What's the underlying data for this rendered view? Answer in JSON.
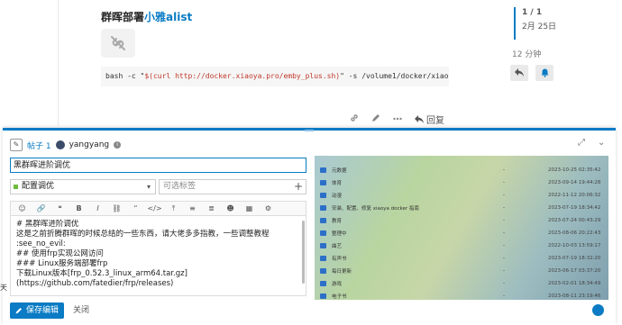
{
  "post": {
    "title_prefix": "群晖部署",
    "title_link": "小雅alist",
    "code_text_before": "bash -c \"",
    "code_string": "$(curl http://docker.xiaoya.pro/emby_plus.sh)",
    "code_text_after": "\" -s /volume1/docker/xiaoya-m"
  },
  "post_actions": {
    "reply_label": "回复"
  },
  "timeline": {
    "position": "1 / 1",
    "date": "2月 25日",
    "ago": "12 分钟"
  },
  "composer": {
    "reply_label": "帖子 1",
    "username": "yangyang",
    "title_value": "黑群晖进阶调优",
    "category": "配置调优",
    "category_color": "#6dbb3b",
    "tags_placeholder": "可选标签",
    "editor_text": "# 黑群晖进阶调优\n这是之前折腾群晖的时候总结的一些东西，请大佬多多指教，一些调整教程\n:see_no_evil:\n## 使用frp实现公网访问\n### Linux服务端部署frp\n下载Linux版本[frp_0.52.3_linux_arm64.tar.gz]\n(https://github.com/fatedier/frp/releases)",
    "save_label": "保存编辑",
    "close_label": "关闭",
    "accent_color": "#0a7bc4"
  },
  "preview": {
    "rows": [
      {
        "name": "元数据",
        "size": "-",
        "date": "2023-10-25 02:35:42"
      },
      {
        "name": "体育",
        "size": "-",
        "date": "2023-09-14 19:44:28"
      },
      {
        "name": "动漫",
        "size": "-",
        "date": "2022-11-12 20:06:32"
      },
      {
        "name": "安装、配置、修复 xiaoya docker 指南",
        "size": "-",
        "date": "2023-07-19 18:34:42"
      },
      {
        "name": "教育",
        "size": "-",
        "date": "2023-07-24 00:43:29"
      },
      {
        "name": "整理中",
        "size": "-",
        "date": "2023-08-06 20:22:43"
      },
      {
        "name": "曲艺",
        "size": "-",
        "date": "2022-10-03 13:59:17"
      },
      {
        "name": "有声书",
        "size": "-",
        "date": "2023-07-19 18:32:20"
      },
      {
        "name": "每日更新",
        "size": "-",
        "date": "2023-06-17 03:37:20"
      },
      {
        "name": "游戏",
        "size": "-",
        "date": "2023-02-01 18:34:49"
      },
      {
        "name": "电子书",
        "size": "-",
        "date": "2023-08-11 23:19:46"
      }
    ]
  },
  "edge_text": "天"
}
